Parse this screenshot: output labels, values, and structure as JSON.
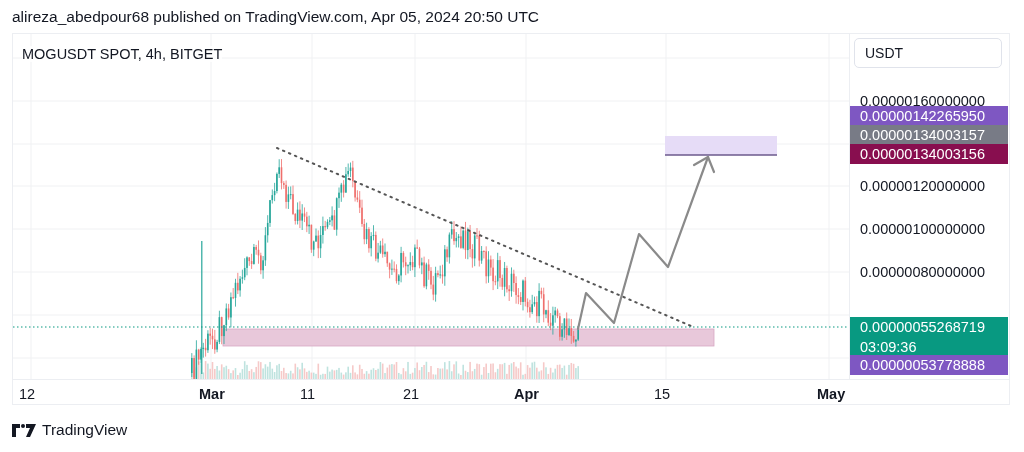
{
  "header": {
    "text": "alireza_abedpour68 published on TradingView.com, Apr 05, 2024 20:50 UTC"
  },
  "chart": {
    "title": "MOGUSDT SPOT, 4h, BITGET",
    "currency": "USDT",
    "price_ticks": [
      "0.00000160000000",
      "0.00000120000000",
      "0.00000100000000",
      "0.00000080000000"
    ],
    "price_labels": [
      {
        "text": "0.00000142265950",
        "color": "#7e57c2"
      },
      {
        "text": "0.00000134003157",
        "color": "#787b86"
      },
      {
        "text": "0.00000134003156",
        "color": "#880e4f"
      },
      {
        "text": "0.00000055268719",
        "countdown": "03:09:36",
        "color": "#089981"
      },
      {
        "text": "0.00000053778888",
        "color": "#7e57c2"
      }
    ],
    "time_labels": [
      {
        "text": "12",
        "bold": false
      },
      {
        "text": "Mar",
        "bold": true
      },
      {
        "text": "11",
        "bold": false
      },
      {
        "text": "21",
        "bold": false
      },
      {
        "text": "Apr",
        "bold": true
      },
      {
        "text": "15",
        "bold": false
      },
      {
        "text": "May",
        "bold": true
      }
    ]
  },
  "footer": {
    "brand": "TradingView"
  }
}
